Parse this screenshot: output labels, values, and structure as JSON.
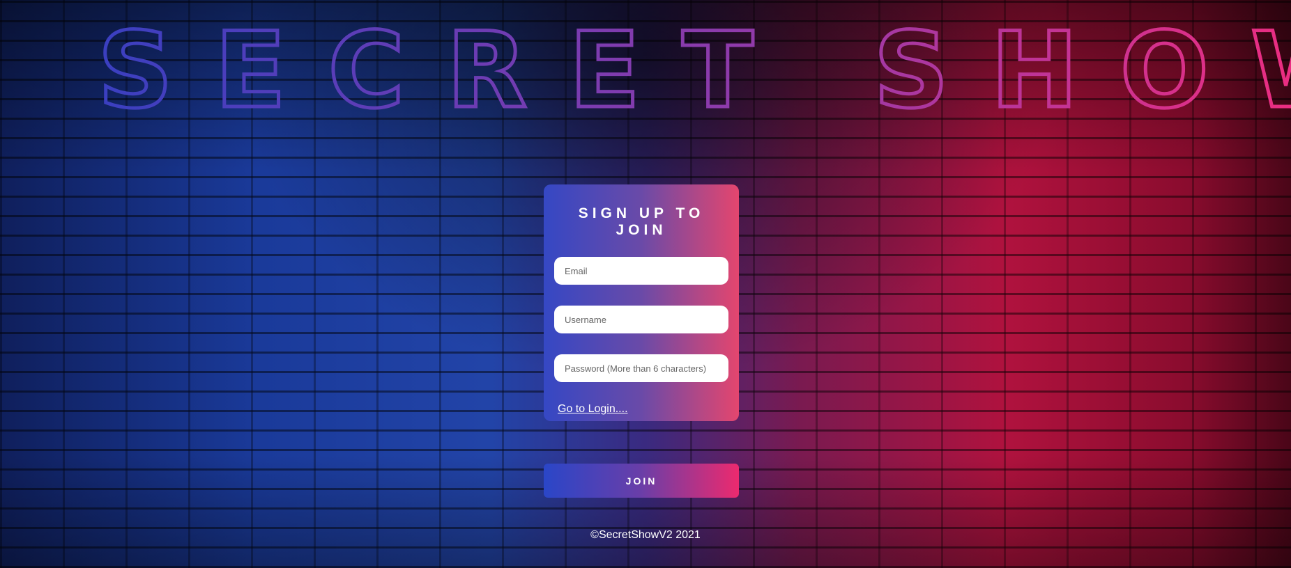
{
  "hero": {
    "title": "SECRET SHOW",
    "gradient_start": "#3a3fc0",
    "gradient_end": "#ff2a78"
  },
  "signup": {
    "heading": "SIGN UP TO JOIN",
    "email_placeholder": "Email",
    "username_placeholder": "Username",
    "password_placeholder": "Password (More than 6 characters)",
    "login_link": "Go to Login....",
    "join_label": "JOIN"
  },
  "footer": {
    "copyright": "©SecretShowV2 2021"
  },
  "colors": {
    "card_left": "#3548c4",
    "card_right": "#e4466e",
    "button_left": "#2a46c8",
    "button_right": "#ec2a6e"
  }
}
